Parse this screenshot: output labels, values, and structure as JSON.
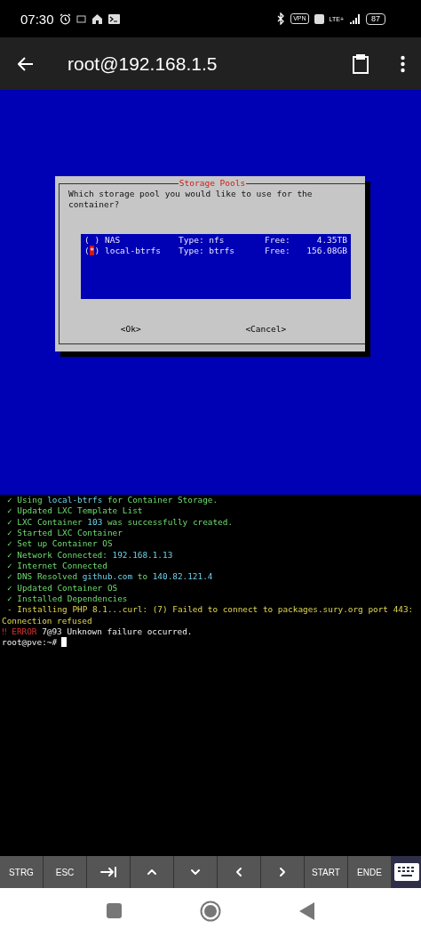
{
  "status_bar": {
    "time": "07:30",
    "vpn": "VPN",
    "network": "LTE+",
    "battery": "87"
  },
  "app_bar": {
    "title": "root@192.168.1.5"
  },
  "dialog": {
    "title": "Storage Pools",
    "prompt": "Which storage pool you would like to use for the container?",
    "options": [
      {
        "radio": "( )",
        "name": "NAS",
        "type": "Type: nfs",
        "free_label": "Free:",
        "free": "4.35TB",
        "selected": false
      },
      {
        "radio": "(*)",
        "name": "local-btrfs",
        "type": "Type: btrfs",
        "free_label": "Free:",
        "free": "156.08GB",
        "selected": true
      }
    ],
    "buttons": [
      "<Ok>",
      "<Cancel>"
    ]
  },
  "terminal": [
    {
      "kind": "success",
      "mark": "✓",
      "segments": [
        {
          "text": "Using ",
          "kind": "plain"
        },
        {
          "text": "local-btrfs",
          "kind": "value"
        },
        {
          "text": " for Container Storage.",
          "kind": "plain"
        }
      ]
    },
    {
      "kind": "success",
      "mark": "✓",
      "segments": [
        {
          "text": "Updated LXC Template List",
          "kind": "plain"
        }
      ]
    },
    {
      "kind": "success",
      "mark": "✓",
      "segments": [
        {
          "text": "LXC Container ",
          "kind": "plain"
        },
        {
          "text": "103",
          "kind": "value"
        },
        {
          "text": " was successfully created.",
          "kind": "plain"
        }
      ]
    },
    {
      "kind": "success",
      "mark": "✓",
      "segments": [
        {
          "text": "Started LXC Container",
          "kind": "plain"
        }
      ]
    },
    {
      "kind": "success",
      "mark": "✓",
      "segments": [
        {
          "text": "Set up Container OS",
          "kind": "plain"
        }
      ]
    },
    {
      "kind": "success",
      "mark": "✓",
      "segments": [
        {
          "text": "Network Connected: ",
          "kind": "plain"
        },
        {
          "text": "192.168.1.13",
          "kind": "value"
        }
      ]
    },
    {
      "kind": "success",
      "mark": "✓",
      "segments": [
        {
          "text": "Internet Connected",
          "kind": "plain"
        }
      ]
    },
    {
      "kind": "success",
      "mark": "✓",
      "segments": [
        {
          "text": "DNS Resolved ",
          "kind": "plain"
        },
        {
          "text": "github.com",
          "kind": "value"
        },
        {
          "text": " to ",
          "kind": "plain"
        },
        {
          "text": "140.82.121.4",
          "kind": "value"
        }
      ]
    },
    {
      "kind": "success",
      "mark": "✓",
      "segments": [
        {
          "text": "Updated Container OS",
          "kind": "plain"
        }
      ]
    },
    {
      "kind": "success",
      "mark": "✓",
      "segments": [
        {
          "text": "Installed Dependencies",
          "kind": "plain"
        }
      ]
    },
    {
      "kind": "progress",
      "mark": "-",
      "segments": [
        {
          "text": "Installing PHP 8.1...curl: (7) Failed to connect to packages.sury.org port 443:",
          "kind": "plain"
        }
      ]
    },
    {
      "kind": "progress",
      "segments": [
        {
          "text": "Connection refused",
          "kind": "plain"
        }
      ]
    },
    {
      "kind": "error",
      "mark": "‼ ERROR",
      "segments": [
        {
          "text": "7@93 Unknown failure occurred.",
          "kind": "plain"
        }
      ]
    },
    {
      "kind": "prompt",
      "segments": [
        {
          "text": "root@pve:~#",
          "kind": "plain"
        }
      ]
    }
  ],
  "keys": [
    {
      "kind": "text",
      "label": "STRG"
    },
    {
      "kind": "text",
      "label": "ESC"
    },
    {
      "kind": "tab"
    },
    {
      "kind": "up"
    },
    {
      "kind": "down"
    },
    {
      "kind": "left"
    },
    {
      "kind": "right"
    },
    {
      "kind": "text",
      "label": "START"
    },
    {
      "kind": "text",
      "label": "ENDE"
    }
  ]
}
